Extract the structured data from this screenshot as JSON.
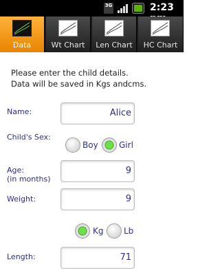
{
  "status_bar": {
    "network": "3G",
    "time": "2:23 pm",
    "icons": [
      "3g-icon",
      "signal-icon",
      "battery-icon"
    ]
  },
  "tabs": [
    {
      "label": "Data",
      "active": true,
      "icon": "chart-icon"
    },
    {
      "label": "Wt Chart",
      "active": false,
      "icon": "chart-icon"
    },
    {
      "label": "Len Chart",
      "active": false,
      "icon": "chart-icon"
    },
    {
      "label": "HC Chart",
      "active": false,
      "icon": "chart-icon"
    }
  ],
  "intro": {
    "line1": "Please enter the child details.",
    "line2": "Data will be saved in Kgs andcms."
  },
  "form": {
    "name": {
      "label": "Name:",
      "value": "Alice"
    },
    "sex": {
      "label": "Child's Sex:",
      "options": [
        {
          "label": "Boy",
          "selected": false
        },
        {
          "label": "Girl",
          "selected": true
        }
      ]
    },
    "age": {
      "label_line1": "Age:",
      "label_line2": "(in months)",
      "value": "9"
    },
    "weight": {
      "label": "Weight:",
      "value": "9"
    },
    "unit": {
      "options": [
        {
          "label": "Kg",
          "selected": true
        },
        {
          "label": "Lb",
          "selected": false
        }
      ]
    },
    "length": {
      "label": "Length:",
      "value": "71"
    }
  },
  "colors": {
    "accent": "#f39c12",
    "label": "#2e2e8a",
    "radio_on": "#3da31b"
  }
}
